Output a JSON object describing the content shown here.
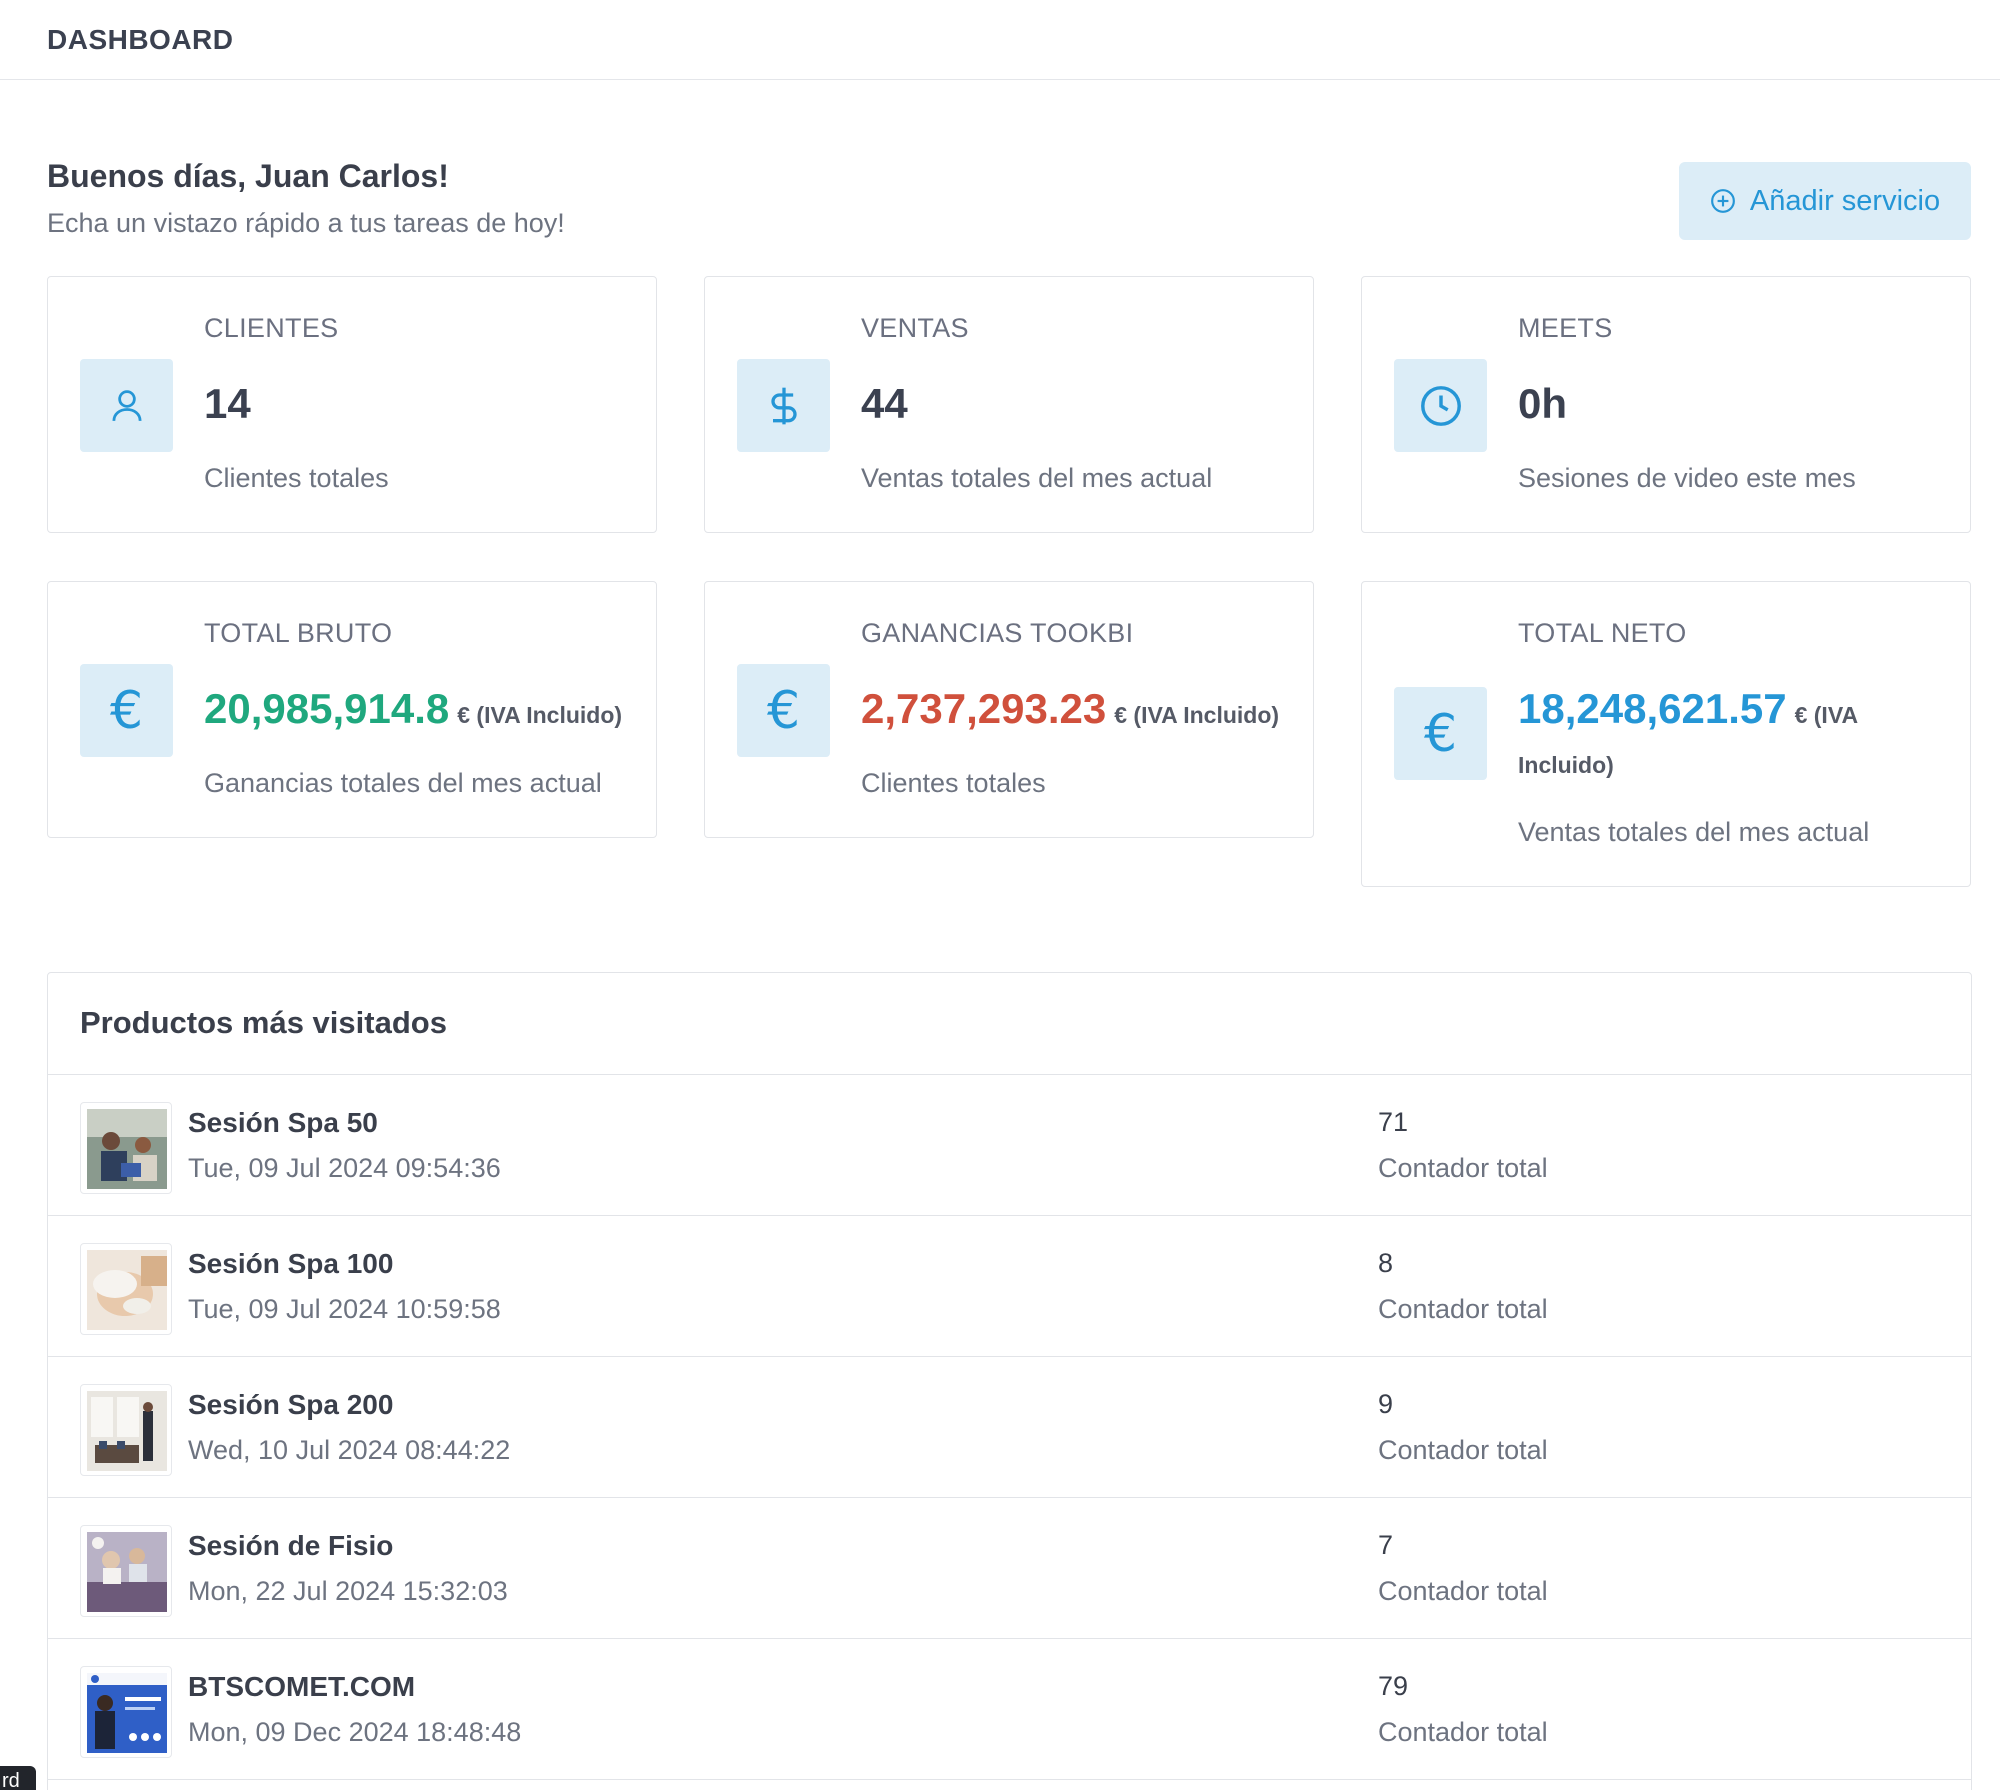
{
  "header": {
    "title": "DASHBOARD"
  },
  "greeting": {
    "title": "Buenos días, Juan Carlos!",
    "subtitle": "Echa un vistazo rápido a tus tareas de hoy!"
  },
  "actions": {
    "add_service_label": "Añadir servicio"
  },
  "stats": {
    "clientes": {
      "label": "CLIENTES",
      "value": "14",
      "desc": "Clientes totales",
      "icon": "user-icon"
    },
    "ventas": {
      "label": "VENTAS",
      "value": "44",
      "desc": "Ventas totales del mes actual",
      "icon": "dollar-icon"
    },
    "meets": {
      "label": "MEETS",
      "value": "0h",
      "desc": "Sesiones de video este mes",
      "icon": "clock-icon"
    },
    "total_bruto": {
      "label": "TOTAL BRUTO",
      "value": "20,985,914.8",
      "suffix": "€ (IVA Incluido)",
      "desc": "Ganancias totales del mes actual",
      "icon": "euro-icon",
      "color": "#1fa87e"
    },
    "ganancias": {
      "label": "GANANCIAS TOOKBI",
      "value": "2,737,293.23",
      "suffix": "€ (IVA Incluido)",
      "desc": "Clientes totales",
      "icon": "euro-icon",
      "color": "#d0503c"
    },
    "total_neto": {
      "label": "TOTAL NETO",
      "value": "18,248,621.57",
      "suffix_1": "€ (IVA",
      "suffix_2": "Incluido)",
      "desc": "Ventas totales del mes actual",
      "icon": "euro-icon",
      "color": "#2596d6"
    }
  },
  "products": {
    "title": "Productos más visitados",
    "items": [
      {
        "name": "Sesión Spa 50",
        "date": "Tue, 09 Jul 2024 09:54:36",
        "count": "71",
        "count_label": "Contador total"
      },
      {
        "name": "Sesión Spa 100",
        "date": "Tue, 09 Jul 2024 10:59:58",
        "count": "8",
        "count_label": "Contador total"
      },
      {
        "name": "Sesión Spa 200",
        "date": "Wed, 10 Jul 2024 08:44:22",
        "count": "9",
        "count_label": "Contador total"
      },
      {
        "name": "Sesión de Fisio",
        "date": "Mon, 22 Jul 2024 15:32:03",
        "count": "7",
        "count_label": "Contador total"
      },
      {
        "name": "BTSCOMET.COM",
        "date": "Mon, 09 Dec 2024 18:48:48",
        "count": "79",
        "count_label": "Contador total"
      }
    ]
  },
  "colors": {
    "accent": "#2596d6",
    "accent_bg": "#dcedf7",
    "green": "#1fa87e",
    "red": "#d0503c"
  },
  "corner_chip": "rd"
}
